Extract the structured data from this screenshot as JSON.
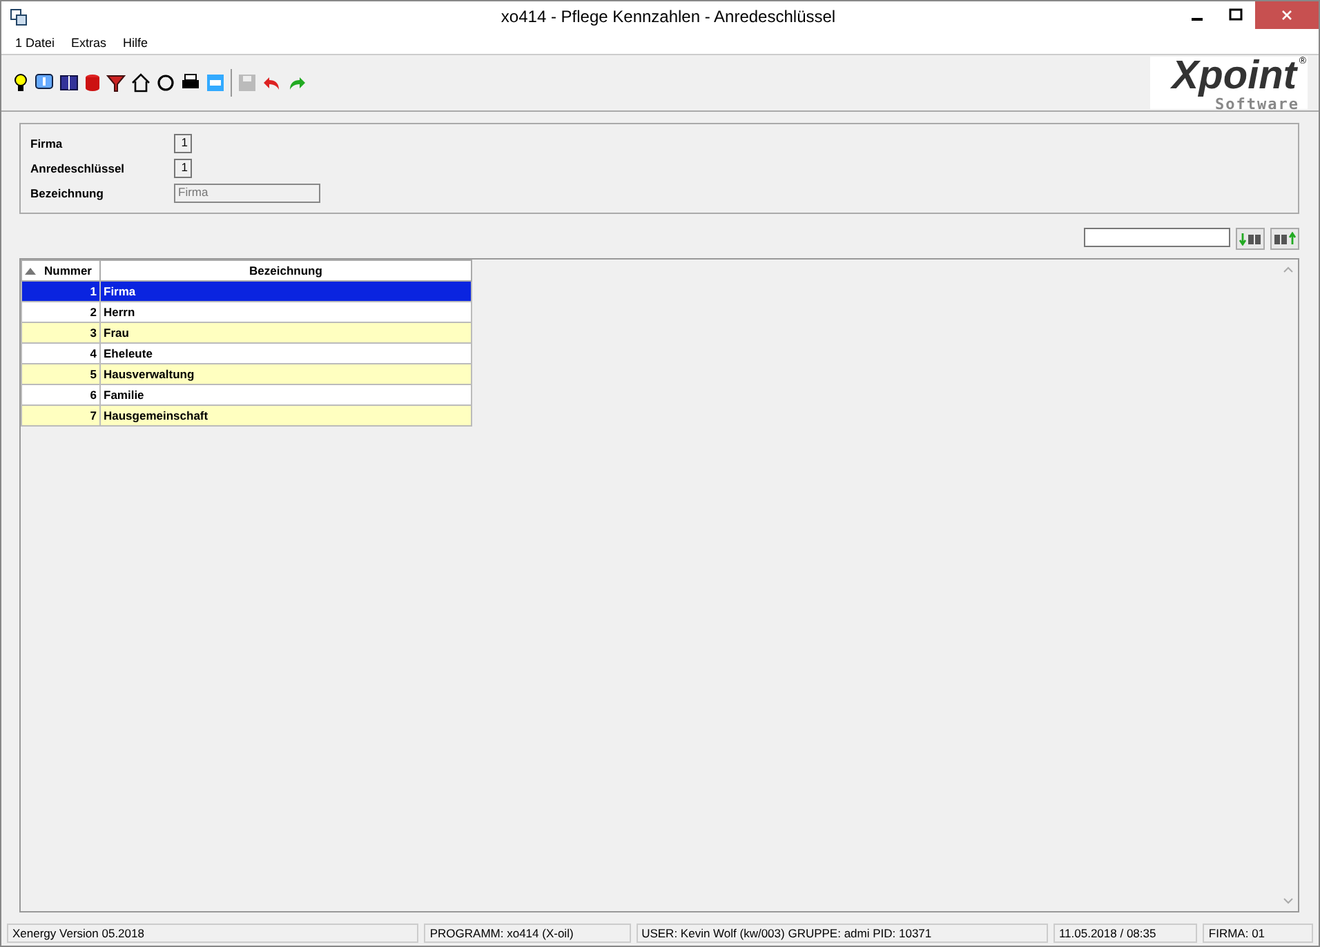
{
  "window": {
    "title": "xo414 - Pflege Kennzahlen - Anredeschlüssel"
  },
  "menu": [
    "1 Datei",
    "Extras",
    "Hilfe"
  ],
  "logo": {
    "word": "Xpoint",
    "sub": "Software",
    "mark": "®"
  },
  "form": [
    {
      "label": "Firma",
      "value": "1",
      "kind": "number"
    },
    {
      "label": "Anredeschlüssel",
      "value": "1",
      "kind": "number"
    },
    {
      "label": "Bezeichnung",
      "value": "Firma",
      "kind": "text"
    }
  ],
  "table": {
    "columns": [
      "Nummer",
      "Bezeichnung"
    ],
    "rows": [
      {
        "nummer": "1",
        "bezeichnung": "Firma",
        "selected": true
      },
      {
        "nummer": "2",
        "bezeichnung": "Herrn",
        "selected": false
      },
      {
        "nummer": "3",
        "bezeichnung": "Frau",
        "selected": false
      },
      {
        "nummer": "4",
        "bezeichnung": "Eheleute",
        "selected": false
      },
      {
        "nummer": "5",
        "bezeichnung": "Hausverwaltung",
        "selected": false
      },
      {
        "nummer": "6",
        "bezeichnung": "Familie",
        "selected": false
      },
      {
        "nummer": "7",
        "bezeichnung": "Hausgemeinschaft",
        "selected": false
      }
    ]
  },
  "status_bar": [
    "Xenergy Version 05.2018",
    "PROGRAMM: xo414 (X-oil)",
    "USER: Kevin Wolf (kw/003)  GRUPPE: admi  PID: 10371",
    "11.05.2018 / 08:35",
    "FIRMA: 01"
  ]
}
